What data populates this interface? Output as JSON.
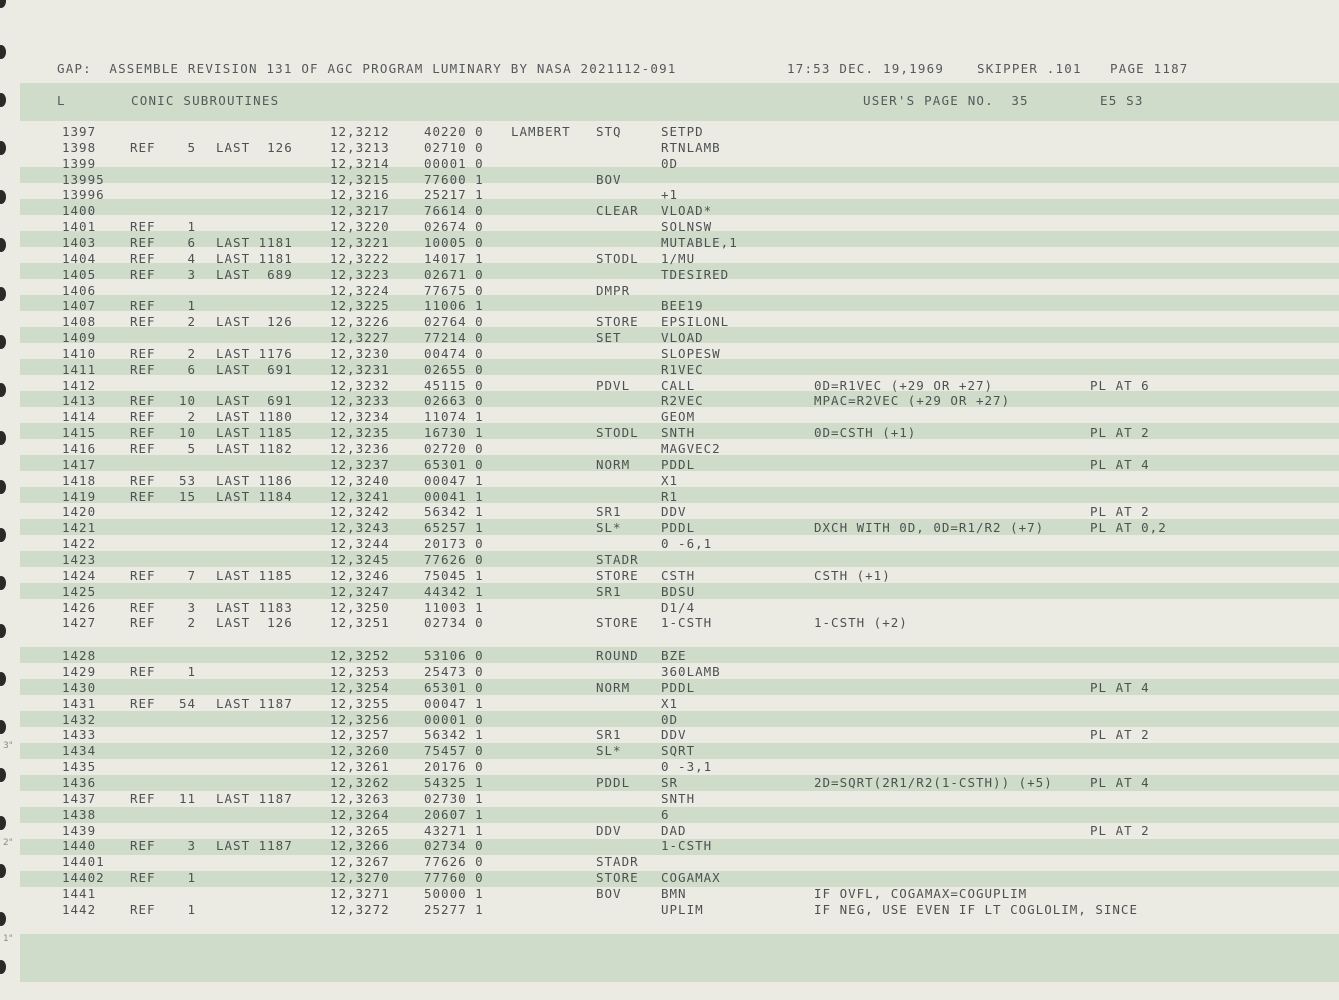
{
  "header": {
    "left": "GAP:  ASSEMBLE REVISION 131 OF AGC PROGRAM LUMINARY BY NASA 2021112-091",
    "time": "17:53 DEC. 19,1969",
    "skipper": "SKIPPER .101",
    "page": "PAGE 1187"
  },
  "title_row": {
    "letter": "L",
    "section": "CONIC SUBROUTINES",
    "users_page": "USER'S PAGE NO.  35",
    "code": "E5 S3"
  },
  "margin_marks": [
    "3\"",
    "2\"",
    "1\""
  ],
  "rows": [
    {
      "line": "1397",
      "ref": "",
      "refn": "",
      "last": "",
      "addr": "12,3212",
      "word": "40220 0",
      "label": "LAMBERT",
      "op": "STQ",
      "operand": "SETPD",
      "comment": "",
      "pl": ""
    },
    {
      "line": "1398",
      "ref": "REF",
      "refn": "5",
      "last": "LAST  126",
      "addr": "12,3213",
      "word": "02710 0",
      "label": "",
      "op": "",
      "operand": "RTNLAMB",
      "comment": "",
      "pl": ""
    },
    {
      "line": "1399",
      "ref": "",
      "refn": "",
      "last": "",
      "addr": "12,3214",
      "word": "00001 0",
      "label": "",
      "op": "",
      "operand": "0D",
      "comment": "",
      "pl": ""
    },
    {
      "line": "13995",
      "ref": "",
      "refn": "",
      "last": "",
      "addr": "12,3215",
      "word": "77600 1",
      "label": "",
      "op": "BOV",
      "operand": "",
      "comment": "",
      "pl": ""
    },
    {
      "line": "13996",
      "ref": "",
      "refn": "",
      "last": "",
      "addr": "12,3216",
      "word": "25217 1",
      "label": "",
      "op": "",
      "operand": "+1",
      "comment": "",
      "pl": ""
    },
    {
      "line": "1400",
      "ref": "",
      "refn": "",
      "last": "",
      "addr": "12,3217",
      "word": "76614 0",
      "label": "",
      "op": "CLEAR",
      "operand": "VLOAD*",
      "comment": "",
      "pl": ""
    },
    {
      "line": "1401",
      "ref": "REF",
      "refn": "1",
      "last": "",
      "addr": "12,3220",
      "word": "02674 0",
      "label": "",
      "op": "",
      "operand": "SOLNSW",
      "comment": "",
      "pl": ""
    },
    {
      "line": "1403",
      "ref": "REF",
      "refn": "6",
      "last": "LAST 1181",
      "addr": "12,3221",
      "word": "10005 0",
      "label": "",
      "op": "",
      "operand": "MUTABLE,1",
      "comment": "",
      "pl": ""
    },
    {
      "line": "1404",
      "ref": "REF",
      "refn": "4",
      "last": "LAST 1181",
      "addr": "12,3222",
      "word": "14017 1",
      "label": "",
      "op": "STODL",
      "operand": "1/MU",
      "comment": "",
      "pl": ""
    },
    {
      "line": "1405",
      "ref": "REF",
      "refn": "3",
      "last": "LAST  689",
      "addr": "12,3223",
      "word": "02671 0",
      "label": "",
      "op": "",
      "operand": "TDESIRED",
      "comment": "",
      "pl": ""
    },
    {
      "line": "1406",
      "ref": "",
      "refn": "",
      "last": "",
      "addr": "12,3224",
      "word": "77675 0",
      "label": "",
      "op": "DMPR",
      "operand": "",
      "comment": "",
      "pl": ""
    },
    {
      "line": "1407",
      "ref": "REF",
      "refn": "1",
      "last": "",
      "addr": "12,3225",
      "word": "11006 1",
      "label": "",
      "op": "",
      "operand": "BEE19",
      "comment": "",
      "pl": ""
    },
    {
      "line": "1408",
      "ref": "REF",
      "refn": "2",
      "last": "LAST  126",
      "addr": "12,3226",
      "word": "02764 0",
      "label": "",
      "op": "STORE",
      "operand": "EPSILONL",
      "comment": "",
      "pl": ""
    },
    {
      "line": "1409",
      "ref": "",
      "refn": "",
      "last": "",
      "addr": "12,3227",
      "word": "77214 0",
      "label": "",
      "op": "SET",
      "operand": "VLOAD",
      "comment": "",
      "pl": ""
    },
    {
      "line": "1410",
      "ref": "REF",
      "refn": "2",
      "last": "LAST 1176",
      "addr": "12,3230",
      "word": "00474 0",
      "label": "",
      "op": "",
      "operand": "SLOPESW",
      "comment": "",
      "pl": ""
    },
    {
      "line": "1411",
      "ref": "REF",
      "refn": "6",
      "last": "LAST  691",
      "addr": "12,3231",
      "word": "02655 0",
      "label": "",
      "op": "",
      "operand": "R1VEC",
      "comment": "",
      "pl": ""
    },
    {
      "line": "1412",
      "ref": "",
      "refn": "",
      "last": "",
      "addr": "12,3232",
      "word": "45115 0",
      "label": "",
      "op": "PDVL",
      "operand": "CALL",
      "comment": "0D=R1VEC (+29 OR +27)",
      "pl": "PL AT 6"
    },
    {
      "line": "1413",
      "ref": "REF",
      "refn": "10",
      "last": "LAST  691",
      "addr": "12,3233",
      "word": "02663 0",
      "label": "",
      "op": "",
      "operand": "R2VEC",
      "comment": "MPAC=R2VEC (+29 OR +27)",
      "pl": ""
    },
    {
      "line": "1414",
      "ref": "REF",
      "refn": "2",
      "last": "LAST 1180",
      "addr": "12,3234",
      "word": "11074 1",
      "label": "",
      "op": "",
      "operand": "GEOM",
      "comment": "",
      "pl": ""
    },
    {
      "line": "1415",
      "ref": "REF",
      "refn": "10",
      "last": "LAST 1185",
      "addr": "12,3235",
      "word": "16730 1",
      "label": "",
      "op": "STODL",
      "operand": "SNTH",
      "comment": "0D=CSTH (+1)",
      "pl": "PL AT 2"
    },
    {
      "line": "1416",
      "ref": "REF",
      "refn": "5",
      "last": "LAST 1182",
      "addr": "12,3236",
      "word": "02720 0",
      "label": "",
      "op": "",
      "operand": "MAGVEC2",
      "comment": "",
      "pl": ""
    },
    {
      "line": "1417",
      "ref": "",
      "refn": "",
      "last": "",
      "addr": "12,3237",
      "word": "65301 0",
      "label": "",
      "op": "NORM",
      "operand": "PDDL",
      "comment": "",
      "pl": "PL AT 4"
    },
    {
      "line": "1418",
      "ref": "REF",
      "refn": "53",
      "last": "LAST 1186",
      "addr": "12,3240",
      "word": "00047 1",
      "label": "",
      "op": "",
      "operand": "X1",
      "comment": "",
      "pl": ""
    },
    {
      "line": "1419",
      "ref": "REF",
      "refn": "15",
      "last": "LAST 1184",
      "addr": "12,3241",
      "word": "00041 1",
      "label": "",
      "op": "",
      "operand": "R1",
      "comment": "",
      "pl": ""
    },
    {
      "line": "1420",
      "ref": "",
      "refn": "",
      "last": "",
      "addr": "12,3242",
      "word": "56342 1",
      "label": "",
      "op": "SR1",
      "operand": "DDV",
      "comment": "",
      "pl": "PL AT 2"
    },
    {
      "line": "1421",
      "ref": "",
      "refn": "",
      "last": "",
      "addr": "12,3243",
      "word": "65257 1",
      "label": "",
      "op": "SL*",
      "operand": "PDDL",
      "comment": "DXCH WITH 0D, 0D=R1/R2 (+7)",
      "pl": "PL AT 0,2"
    },
    {
      "line": "1422",
      "ref": "",
      "refn": "",
      "last": "",
      "addr": "12,3244",
      "word": "20173 0",
      "label": "",
      "op": "",
      "operand": "0 -6,1",
      "comment": "",
      "pl": ""
    },
    {
      "line": "1423",
      "ref": "",
      "refn": "",
      "last": "",
      "addr": "12,3245",
      "word": "77626 0",
      "label": "",
      "op": "STADR",
      "operand": "",
      "comment": "",
      "pl": ""
    },
    {
      "line": "1424",
      "ref": "REF",
      "refn": "7",
      "last": "LAST 1185",
      "addr": "12,3246",
      "word": "75045 1",
      "label": "",
      "op": "STORE",
      "operand": "CSTH",
      "comment": "CSTH (+1)",
      "pl": ""
    },
    {
      "line": "1425",
      "ref": "",
      "refn": "",
      "last": "",
      "addr": "12,3247",
      "word": "44342 1",
      "label": "",
      "op": "SR1",
      "operand": "BDSU",
      "comment": "",
      "pl": ""
    },
    {
      "line": "1426",
      "ref": "REF",
      "refn": "3",
      "last": "LAST 1183",
      "addr": "12,3250",
      "word": "11003 1",
      "label": "",
      "op": "",
      "operand": "D1/4",
      "comment": "",
      "pl": ""
    },
    {
      "line": "1427",
      "ref": "REF",
      "refn": "2",
      "last": "LAST  126",
      "addr": "12,3251",
      "word": "02734 0",
      "label": "",
      "op": "STORE",
      "operand": "1-CSTH",
      "comment": "1-CSTH (+2)",
      "pl": ""
    },
    {
      "line": "1428",
      "ref": "",
      "refn": "",
      "last": "",
      "addr": "12,3252",
      "word": "53106 0",
      "label": "",
      "op": "ROUND",
      "operand": "BZE",
      "comment": "",
      "pl": ""
    },
    {
      "line": "1429",
      "ref": "REF",
      "refn": "1",
      "last": "",
      "addr": "12,3253",
      "word": "25473 0",
      "label": "",
      "op": "",
      "operand": "360LAMB",
      "comment": "",
      "pl": ""
    },
    {
      "line": "1430",
      "ref": "",
      "refn": "",
      "last": "",
      "addr": "12,3254",
      "word": "65301 0",
      "label": "",
      "op": "NORM",
      "operand": "PDDL",
      "comment": "",
      "pl": "PL AT 4"
    },
    {
      "line": "1431",
      "ref": "REF",
      "refn": "54",
      "last": "LAST 1187",
      "addr": "12,3255",
      "word": "00047 1",
      "label": "",
      "op": "",
      "operand": "X1",
      "comment": "",
      "pl": ""
    },
    {
      "line": "1432",
      "ref": "",
      "refn": "",
      "last": "",
      "addr": "12,3256",
      "word": "00001 0",
      "label": "",
      "op": "",
      "operand": "0D",
      "comment": "",
      "pl": ""
    },
    {
      "line": "1433",
      "ref": "",
      "refn": "",
      "last": "",
      "addr": "12,3257",
      "word": "56342 1",
      "label": "",
      "op": "SR1",
      "operand": "DDV",
      "comment": "",
      "pl": "PL AT 2"
    },
    {
      "line": "1434",
      "ref": "",
      "refn": "",
      "last": "",
      "addr": "12,3260",
      "word": "75457 0",
      "label": "",
      "op": "SL*",
      "operand": "SQRT",
      "comment": "",
      "pl": ""
    },
    {
      "line": "1435",
      "ref": "",
      "refn": "",
      "last": "",
      "addr": "12,3261",
      "word": "20176 0",
      "label": "",
      "op": "",
      "operand": "0 -3,1",
      "comment": "",
      "pl": ""
    },
    {
      "line": "1436",
      "ref": "",
      "refn": "",
      "last": "",
      "addr": "12,3262",
      "word": "54325 1",
      "label": "",
      "op": "PDDL",
      "operand": "SR",
      "comment": "2D=SQRT(2R1/R2(1-CSTH)) (+5)",
      "pl": "PL AT 4"
    },
    {
      "line": "1437",
      "ref": "REF",
      "refn": "11",
      "last": "LAST 1187",
      "addr": "12,3263",
      "word": "02730 1",
      "label": "",
      "op": "",
      "operand": "SNTH",
      "comment": "",
      "pl": ""
    },
    {
      "line": "1438",
      "ref": "",
      "refn": "",
      "last": "",
      "addr": "12,3264",
      "word": "20607 1",
      "label": "",
      "op": "",
      "operand": "6",
      "comment": "",
      "pl": ""
    },
    {
      "line": "1439",
      "ref": "",
      "refn": "",
      "last": "",
      "addr": "12,3265",
      "word": "43271 1",
      "label": "",
      "op": "DDV",
      "operand": "DAD",
      "comment": "",
      "pl": "PL AT 2"
    },
    {
      "line": "1440",
      "ref": "REF",
      "refn": "3",
      "last": "LAST 1187",
      "addr": "12,3266",
      "word": "02734 0",
      "label": "",
      "op": "",
      "operand": "1-CSTH",
      "comment": "",
      "pl": ""
    },
    {
      "line": "14401",
      "ref": "",
      "refn": "",
      "last": "",
      "addr": "12,3267",
      "word": "77626 0",
      "label": "",
      "op": "STADR",
      "operand": "",
      "comment": "",
      "pl": ""
    },
    {
      "line": "14402",
      "ref": "REF",
      "refn": "1",
      "last": "",
      "addr": "12,3270",
      "word": "77760 0",
      "label": "",
      "op": "STORE",
      "operand": "COGAMAX",
      "comment": "",
      "pl": ""
    },
    {
      "line": "1441",
      "ref": "",
      "refn": "",
      "last": "",
      "addr": "12,3271",
      "word": "50000 1",
      "label": "",
      "op": "BOV",
      "operand": "BMN",
      "comment": "IF OVFL, COGAMAX=COGUPLIM",
      "pl": ""
    },
    {
      "line": "1442",
      "ref": "REF",
      "refn": "1",
      "last": "",
      "addr": "12,3272",
      "word": "25277 1",
      "label": "",
      "op": "",
      "operand": "UPLIM",
      "comment": "IF NEG, USE EVEN IF LT COGLOLIM, SINCE",
      "pl": ""
    }
  ]
}
